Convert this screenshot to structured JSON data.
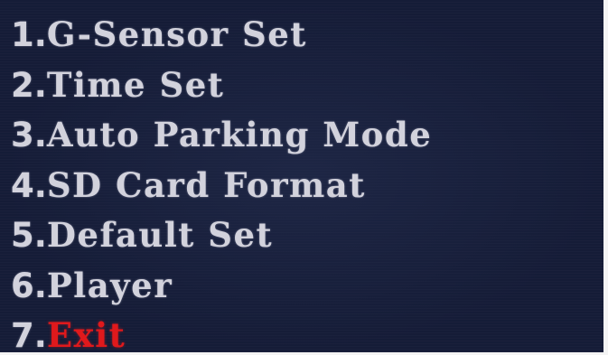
{
  "menu": {
    "items": [
      {
        "number": "1.",
        "label": "G-Sensor Set"
      },
      {
        "number": "2.",
        "label": "Time Set"
      },
      {
        "number": "3.",
        "label": "Auto Parking Mode"
      },
      {
        "number": "4.",
        "label": "SD Card Format"
      },
      {
        "number": "5.",
        "label": "Default Set"
      },
      {
        "number": "6.",
        "label": "Player"
      },
      {
        "number": "7.",
        "label": "Exit"
      }
    ],
    "colors": {
      "background": "#151c37",
      "text": "#d2d2dc",
      "exit_highlight": "#e0191c"
    }
  }
}
